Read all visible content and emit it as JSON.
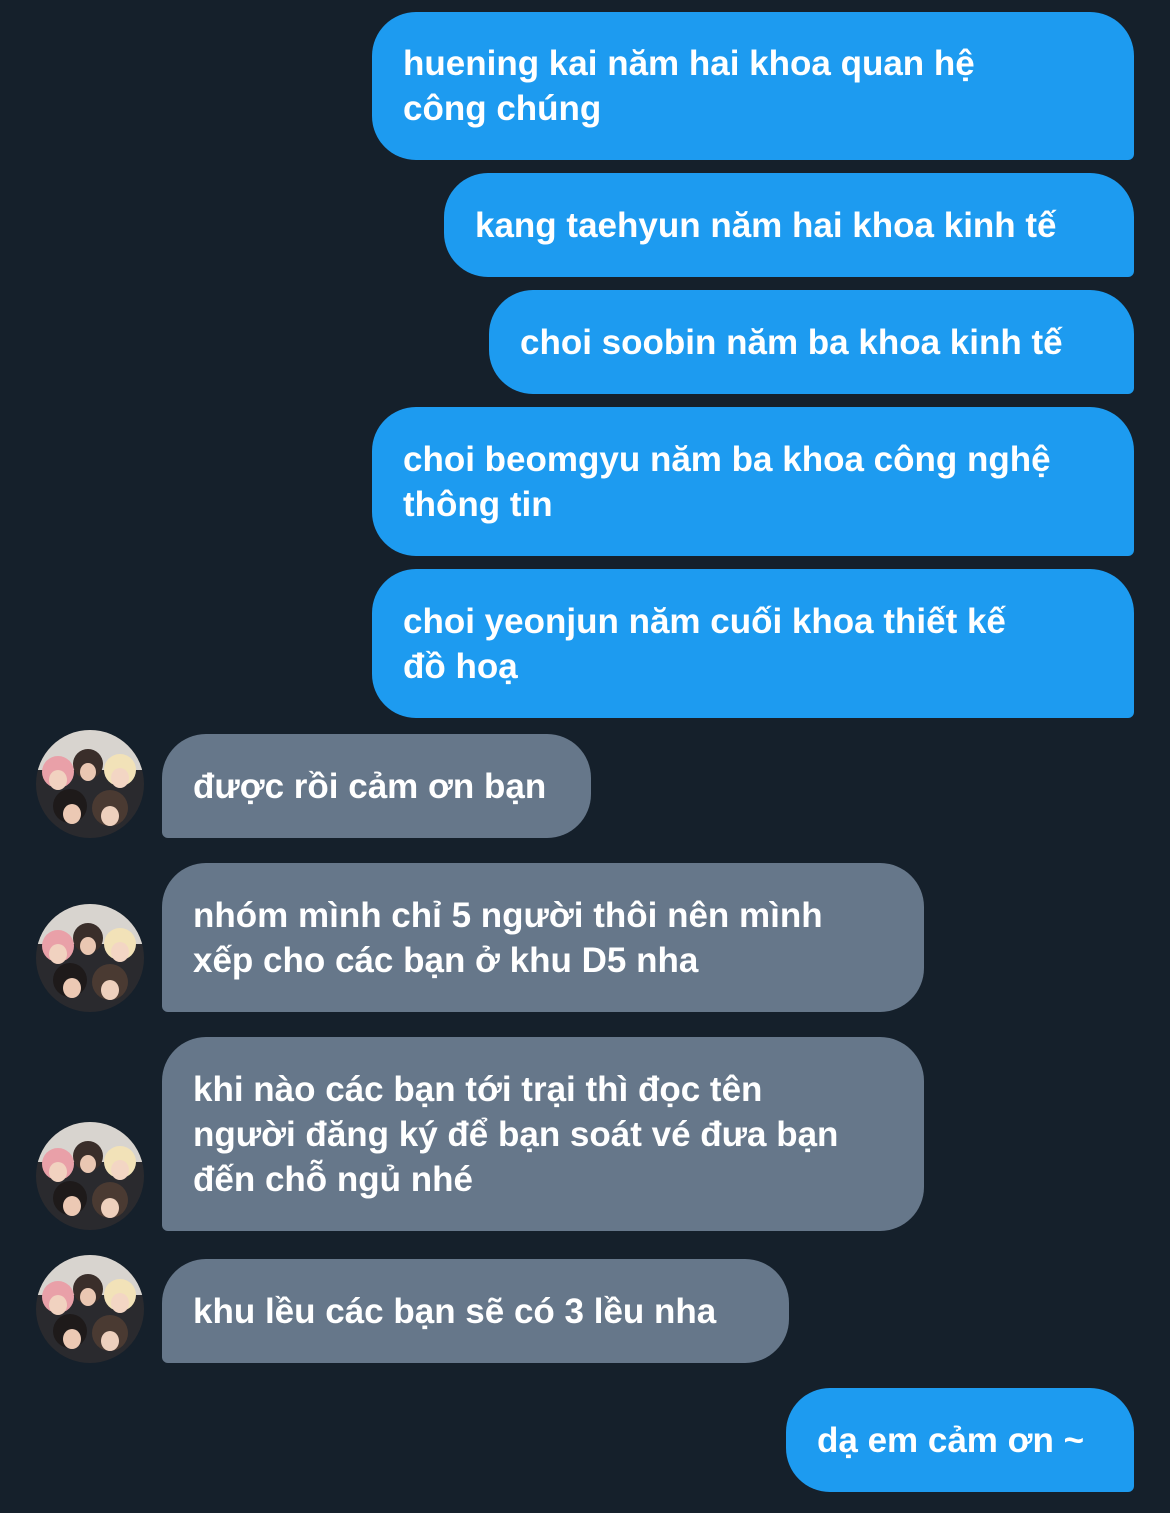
{
  "conversation": {
    "messages": [
      {
        "from": "me",
        "text": "huening kai năm hai khoa quan hệ\ncông chúng"
      },
      {
        "from": "me",
        "text": "kang taehyun năm hai khoa kinh tế"
      },
      {
        "from": "me",
        "text": "choi soobin năm ba khoa kinh tế"
      },
      {
        "from": "me",
        "text": "choi beomgyu năm ba khoa công nghệ\nthông tin"
      },
      {
        "from": "me",
        "text": "choi yeonjun năm cuối khoa thiết kế\nđồ hoạ"
      },
      {
        "from": "them",
        "text": "được rồi cảm ơn bạn"
      },
      {
        "from": "them",
        "text": "nhóm mình chỉ 5 người thôi nên mình\nxếp cho các bạn ở khu D5 nha"
      },
      {
        "from": "them",
        "text": "khi nào các bạn tới trại thì đọc tên\nngười đăng ký để bạn soát vé đưa bạn\nđến chỗ ngủ nhé"
      },
      {
        "from": "them",
        "text": "khu lều các bạn sẽ có 3 lều nha"
      },
      {
        "from": "me",
        "text": "dạ em cảm ơn ~"
      }
    ]
  },
  "colors": {
    "background": "#15202b",
    "sent_bubble": "#1d9bf0",
    "received_bubble": "#66778a",
    "text": "#ffffff"
  },
  "icons": {
    "avatar": "group-photo-avatar"
  }
}
